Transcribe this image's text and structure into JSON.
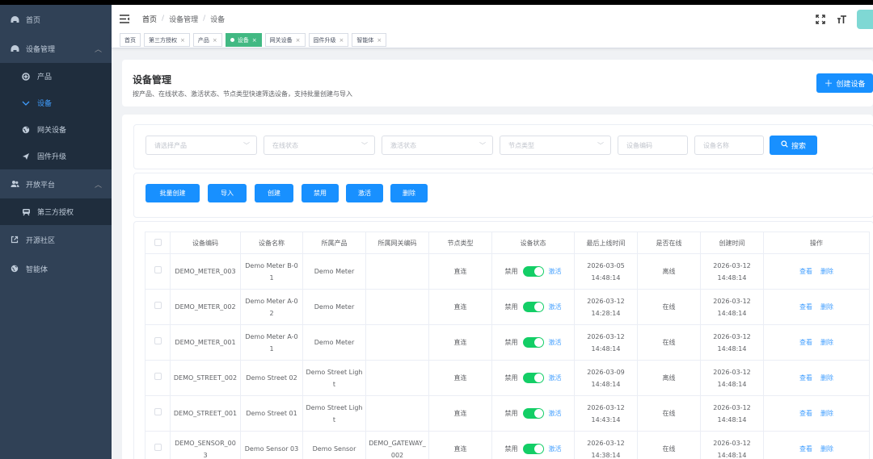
{
  "sidebar": {
    "home": "首页",
    "device_mgmt": "设备管理",
    "device_sub": [
      {
        "label": "产品",
        "icon": "product-icon"
      },
      {
        "label": "设备",
        "icon": "device-icon"
      },
      {
        "label": "网关设备",
        "icon": "gateway-icon"
      },
      {
        "label": "固件升级",
        "icon": "firmware-icon"
      }
    ],
    "open_platform": "开放平台",
    "open_sub": [
      {
        "label": "第三方授权",
        "icon": "auth-icon"
      }
    ],
    "community": "开源社区",
    "agent": "智能体"
  },
  "navbar": {
    "breadcrumb": [
      "首页",
      "设备管理",
      "设备"
    ]
  },
  "tags": [
    {
      "label": "首页"
    },
    {
      "label": "第三方授权"
    },
    {
      "label": "产品"
    },
    {
      "label": "设备",
      "active": true
    },
    {
      "label": "网关设备"
    },
    {
      "label": "固件升级"
    },
    {
      "label": "智能体"
    }
  ],
  "header": {
    "title": "设备管理",
    "subtitle": "按产品、在线状态、激活状态、节点类型快速筛选设备，支持批量创建与导入",
    "create_label": "创建设备"
  },
  "filters": {
    "product": "请选择产品",
    "online": "在线状态",
    "activation": "激活状态",
    "node_type": "节点类型",
    "device_code": "设备编码",
    "device_name": "设备名称",
    "search_label": "搜索"
  },
  "toolbar": {
    "batch_create": "批量创建",
    "import": "导入",
    "create": "创建",
    "disable": "禁用",
    "activate": "激活",
    "delete": "删除"
  },
  "table": {
    "columns": [
      "设备编码",
      "设备名称",
      "所属产品",
      "所属网关编码",
      "节点类型",
      "设备状态",
      "最后上线时间",
      "是否在线",
      "创建时间",
      "操作"
    ],
    "rows": [
      {
        "code": "DEMO_METER_003",
        "name": "Demo Meter B-01",
        "product": "Demo Meter",
        "gateway": "",
        "node": "直连",
        "disabled": "禁用",
        "activated": "激活",
        "last_online": "2026-03-05 14:48:14",
        "online": "离线",
        "created": "2026-03-12 14:48:14",
        "view": "查看",
        "del": "删除"
      },
      {
        "code": "DEMO_METER_002",
        "name": "Demo Meter A-02",
        "product": "Demo Meter",
        "gateway": "",
        "node": "直连",
        "disabled": "禁用",
        "activated": "激活",
        "last_online": "2026-03-12 14:28:14",
        "online": "在线",
        "created": "2026-03-12 14:48:14",
        "view": "查看",
        "del": "删除"
      },
      {
        "code": "DEMO_METER_001",
        "name": "Demo Meter A-01",
        "product": "Demo Meter",
        "gateway": "",
        "node": "直连",
        "disabled": "禁用",
        "activated": "激活",
        "last_online": "2026-03-12 14:48:14",
        "online": "在线",
        "created": "2026-03-12 14:48:14",
        "view": "查看",
        "del": "删除"
      },
      {
        "code": "DEMO_STREET_002",
        "name": "Demo Street 02",
        "product": "Demo Street Light",
        "gateway": "",
        "node": "直连",
        "disabled": "禁用",
        "activated": "激活",
        "last_online": "2026-03-09 14:48:14",
        "online": "离线",
        "created": "2026-03-12 14:48:14",
        "view": "查看",
        "del": "删除"
      },
      {
        "code": "DEMO_STREET_001",
        "name": "Demo Street 01",
        "product": "Demo Street Light",
        "gateway": "",
        "node": "直连",
        "disabled": "禁用",
        "activated": "激活",
        "last_online": "2026-03-12 14:43:14",
        "online": "在线",
        "created": "2026-03-12 14:48:14",
        "view": "查看",
        "del": "删除"
      },
      {
        "code": "DEMO_SENSOR_003",
        "name": "Demo Sensor 03",
        "product": "Demo Sensor",
        "gateway": "DEMO_GATEWAY_002",
        "node": "直连",
        "disabled": "禁用",
        "activated": "激活",
        "last_online": "2026-03-12 14:38:14",
        "online": "在线",
        "created": "2026-03-12 14:48:14",
        "view": "查看",
        "del": "删除"
      }
    ]
  },
  "colors": {
    "sidebar_bg": "#304156",
    "primary": "#1890ff",
    "tag_active": "#42b983",
    "toggle_on": "#13ce66"
  }
}
